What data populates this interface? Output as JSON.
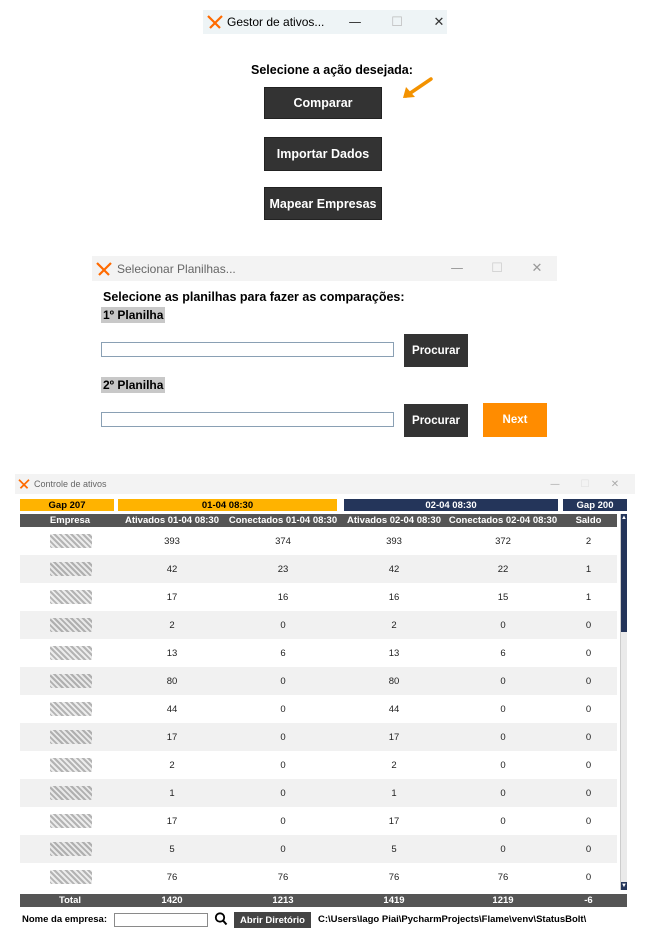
{
  "window1": {
    "title": "Gestor de ativos...",
    "controls": {
      "minimize": "—",
      "maximize": "☐",
      "close": "✕"
    },
    "prompt": "Selecione a ação desejada:",
    "buttons": [
      "Comparar",
      "Importar Dados",
      "Mapear Empresas"
    ],
    "accent": "#ff8c00"
  },
  "window2": {
    "title": "Selecionar Planilhas...",
    "controls": {
      "minimize": "—",
      "maximize": "☐",
      "close": "✕"
    },
    "prompt": "Selecione as planilhas para fazer as comparações:",
    "sheet1_label": "1º Planilha",
    "sheet2_label": "2º Planilha",
    "sheet1_value": "",
    "sheet2_value": "",
    "browse_label": "Procurar",
    "next_label": "Next"
  },
  "window3": {
    "title": "Controle de ativos",
    "controls": {
      "minimize": "—",
      "maximize": "☐",
      "close": "✕"
    },
    "bands": {
      "gap_left": "Gap 207",
      "date_left": "01-04 08:30",
      "date_right": "02-04 08:30",
      "gap_right": "Gap 200"
    },
    "columns": [
      "Empresa",
      "Ativados 01-04 08:30",
      "Conectados 01-04 08:30",
      "Ativados 02-04 08:30",
      "Conectados 02-04 08:30",
      "Saldo"
    ],
    "rows": [
      [
        "393",
        "374",
        "393",
        "372",
        "2"
      ],
      [
        "42",
        "23",
        "42",
        "22",
        "1"
      ],
      [
        "17",
        "16",
        "16",
        "15",
        "1"
      ],
      [
        "2",
        "0",
        "2",
        "0",
        "0"
      ],
      [
        "13",
        "6",
        "13",
        "6",
        "0"
      ],
      [
        "80",
        "0",
        "80",
        "0",
        "0"
      ],
      [
        "44",
        "0",
        "44",
        "0",
        "0"
      ],
      [
        "17",
        "0",
        "17",
        "0",
        "0"
      ],
      [
        "2",
        "0",
        "2",
        "0",
        "0"
      ],
      [
        "1",
        "0",
        "1",
        "0",
        "0"
      ],
      [
        "17",
        "0",
        "17",
        "0",
        "0"
      ],
      [
        "5",
        "0",
        "5",
        "0",
        "0"
      ],
      [
        "76",
        "76",
        "76",
        "76",
        "0"
      ]
    ],
    "total": [
      "Total",
      "1420",
      "1213",
      "1419",
      "1219",
      "-6"
    ],
    "company_label": "Nome da empresa:",
    "company_value": "",
    "open_dir_label": "Abrir Diretório",
    "path": "C:\\Users\\Iago Piai\\PycharmProjects\\Flame\\venv\\StatusBolt\\",
    "colors": {
      "orange": "#ffb300",
      "navy": "#24355a",
      "header_gray": "#555555"
    }
  }
}
